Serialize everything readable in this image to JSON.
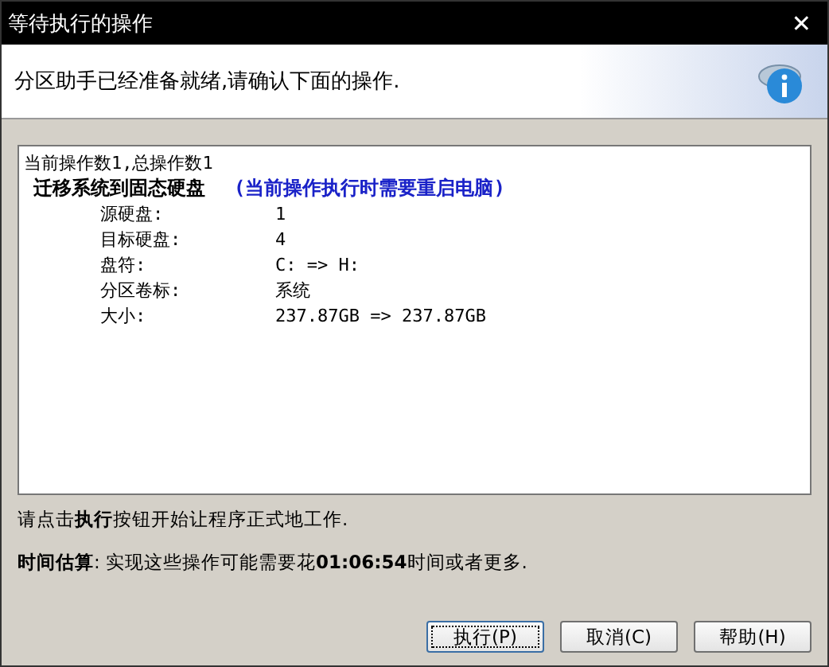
{
  "window": {
    "title": "等待执行的操作",
    "close": "✕"
  },
  "header": {
    "message": "分区助手已经准备就绪,请确认下面的操作."
  },
  "operations": {
    "summary": "当前操作数1,总操作数1",
    "title": "迁移系统到固态硬盘",
    "note": "(当前操作执行时需要重启电脑)",
    "details": [
      {
        "label": "源硬盘:",
        "value": "1"
      },
      {
        "label": "目标硬盘:",
        "value": "4"
      },
      {
        "label": "盘符:",
        "value": "C: => H:"
      },
      {
        "label": "分区卷标:",
        "value": "系统"
      },
      {
        "label": "大小:",
        "value": "237.87GB => 237.87GB"
      }
    ]
  },
  "instruction": "请点击**执行**按钮开始让程序正式地工作.",
  "estimate": "**时间估算**: 实现这些操作可能需要花**01:06:54**时间或者更多.",
  "buttons": [
    {
      "label": "执行(P)",
      "focused": true
    },
    {
      "label": "取消(C)",
      "focused": false
    },
    {
      "label": "帮助(H)",
      "focused": false
    }
  ]
}
